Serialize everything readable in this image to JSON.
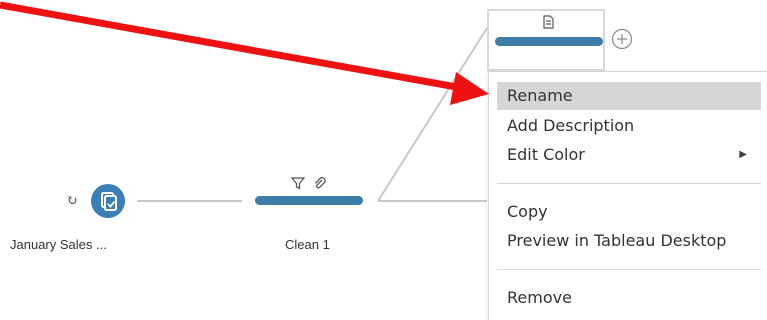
{
  "flow": {
    "source_node": {
      "label": "January Sales ...",
      "icon": "data-source-icon",
      "badge_icon": "union-icon"
    },
    "clean_node": {
      "label": "Clean 1",
      "icons": [
        "filter-icon",
        "paperclip-icon"
      ]
    },
    "selected_node": {
      "icon": "document-icon",
      "add_button": "plus-circle-icon"
    }
  },
  "context_menu": {
    "items": [
      {
        "label": "Rename",
        "highlighted": true
      },
      {
        "label": "Add Description"
      },
      {
        "label": "Edit Color",
        "has_submenu": true,
        "submenu_glyph": "▶"
      },
      {
        "label": "Copy"
      },
      {
        "label": "Preview in Tableau Desktop"
      },
      {
        "label": "Remove"
      }
    ]
  },
  "annotation": {
    "arrow_color": "#ee1111",
    "points_to": "Rename"
  },
  "colors": {
    "node_bar": "#3e7ca8",
    "source_icon": "#3a7fb5",
    "connector": "#c8c8c8",
    "menu_highlight": "#d6d6d6"
  }
}
